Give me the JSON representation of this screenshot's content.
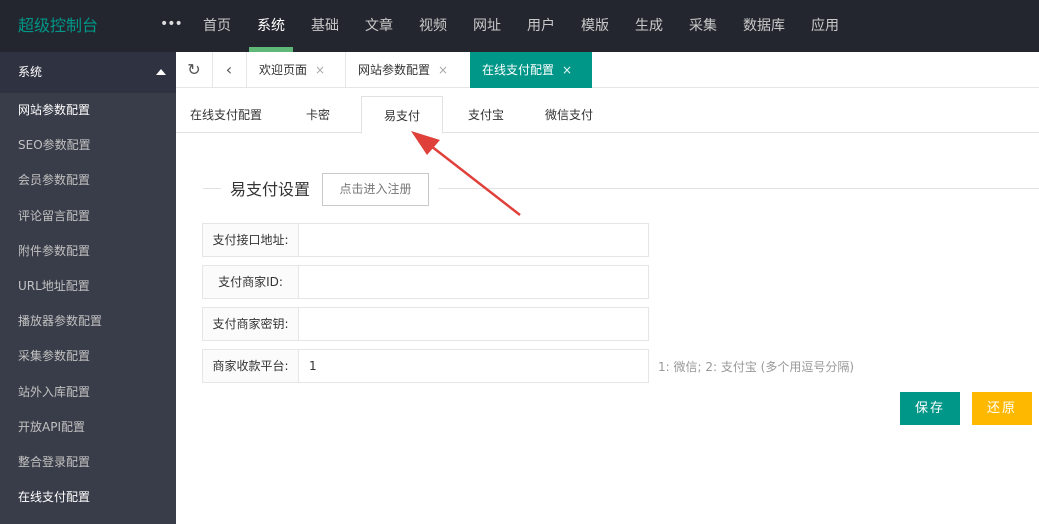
{
  "brand": {
    "title": "超级控制台"
  },
  "topnav": {
    "items": [
      "首页",
      "系统",
      "基础",
      "文章",
      "视频",
      "网址",
      "用户",
      "模版",
      "生成",
      "采集",
      "数据库",
      "应用"
    ],
    "active_index": 1
  },
  "sidebar": {
    "header": "系统",
    "items": [
      "网站参数配置",
      "SEO参数配置",
      "会员参数配置",
      "评论留言配置",
      "附件参数配置",
      "URL地址配置",
      "播放器参数配置",
      "采集参数配置",
      "站外入库配置",
      "开放API配置",
      "整合登录配置",
      "在线支付配置"
    ]
  },
  "tabbar": {
    "tabs": [
      {
        "label": "欢迎页面",
        "close": "×"
      },
      {
        "label": "网站参数配置",
        "close": "×"
      },
      {
        "label": "在线支付配置",
        "close": "×"
      }
    ]
  },
  "subtabs": [
    "在线支付配置",
    "卡密",
    "易支付",
    "支付宝",
    "微信支付"
  ],
  "section": {
    "title": "易支付设置",
    "register_button": "点击进入注册"
  },
  "form": {
    "rows": [
      {
        "label": "支付接口地址:",
        "value": ""
      },
      {
        "label": "支付商家ID:",
        "value": ""
      },
      {
        "label": "支付商家密钥:",
        "value": ""
      },
      {
        "label": "商家收款平台:",
        "value": "1"
      }
    ],
    "hint": "1: 微信; 2: 支付宝 (多个用逗号分隔)"
  },
  "buttons": {
    "save": "保存",
    "reset": "还原"
  },
  "colors": {
    "accent": "#009688",
    "warning": "#ffb800",
    "nav_active": "#5fb878",
    "arrow": "#e0403a"
  }
}
